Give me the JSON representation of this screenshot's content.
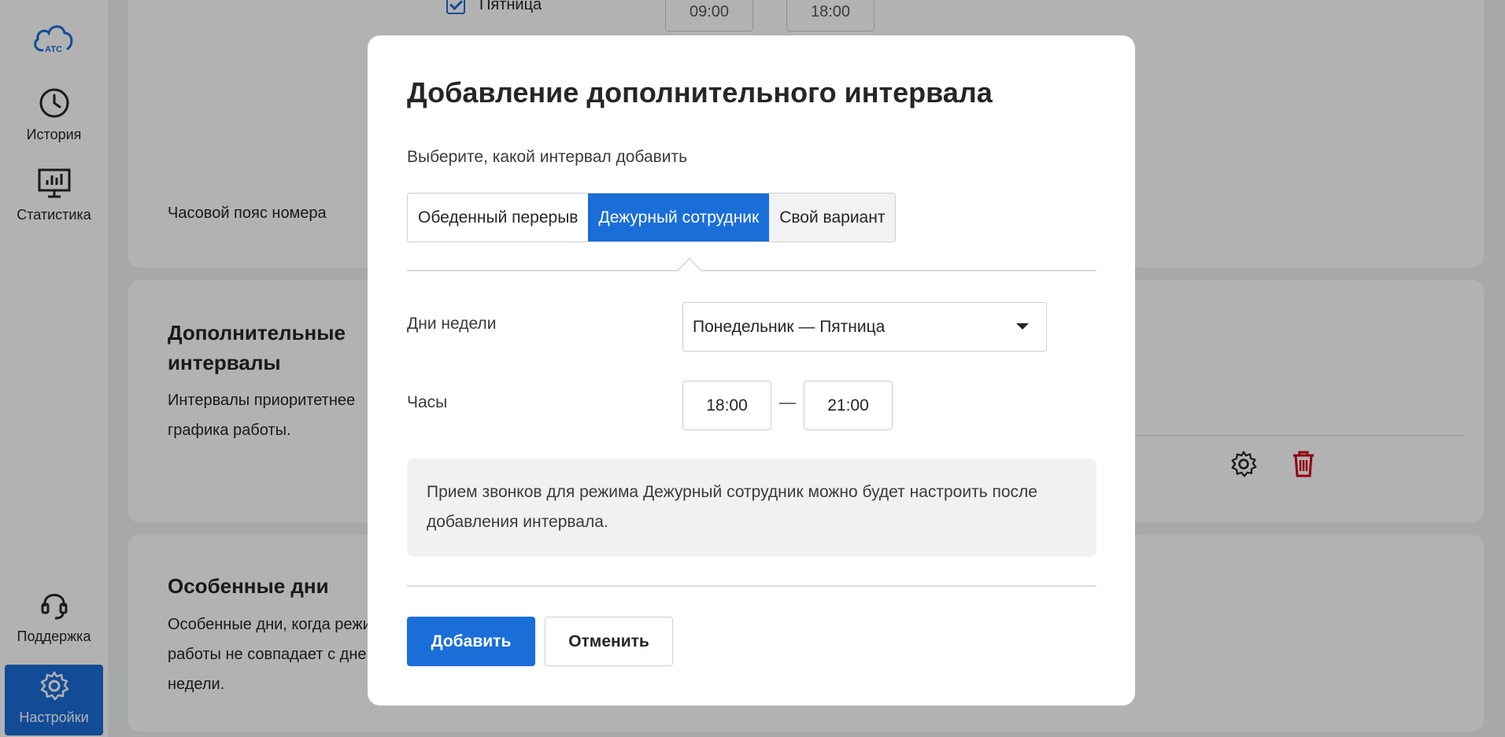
{
  "sidebar": {
    "logo_text": "АТС",
    "items": [
      {
        "label": "История",
        "icon": "clock-icon"
      },
      {
        "label": "Статистика",
        "icon": "chart-monitor-icon"
      },
      {
        "label": "Поддержка",
        "icon": "headset-icon"
      },
      {
        "label": "Настройки",
        "icon": "gear-icon",
        "active": true
      }
    ]
  },
  "background": {
    "friday_row": {
      "label": "Пятница",
      "checked": true,
      "from": "09:00",
      "to": "18:00"
    },
    "timezone_label": "Часовой пояс номера",
    "extra_intervals": {
      "title": "Дополнительные интервалы",
      "title_line1": "Дополнительные",
      "title_line2": "интервалы",
      "desc_line1": "Интервалы приоритетнее",
      "desc_line2": "графика работы."
    },
    "special_days": {
      "title": "Особенные дни",
      "desc_line1": "Особенные дни, когда режи",
      "desc_line2": "работы не совпадает с дне",
      "desc_line3": "недели."
    }
  },
  "modal": {
    "title": "Добавление дополнительного интервала",
    "subtitle": "Выберите, какой интервал добавить",
    "tabs": [
      "Обеденный перерыв",
      "Дежурный сотрудник",
      "Свой вариант"
    ],
    "active_tab": 1,
    "days_label": "Дни недели",
    "days_value": "Понедельник — Пятница",
    "hours_label": "Часы",
    "hours_from": "18:00",
    "hours_dash": "—",
    "hours_to": "21:00",
    "info_text": "Прием звонков для режима Дежурный сотрудник можно будет настроить после добавления интервала.",
    "add_button": "Добавить",
    "cancel_button": "Отменить"
  },
  "colors": {
    "accent": "#1a6ed8",
    "danger": "#d0021b",
    "overlay": "rgba(0,0,0,0.30)"
  }
}
